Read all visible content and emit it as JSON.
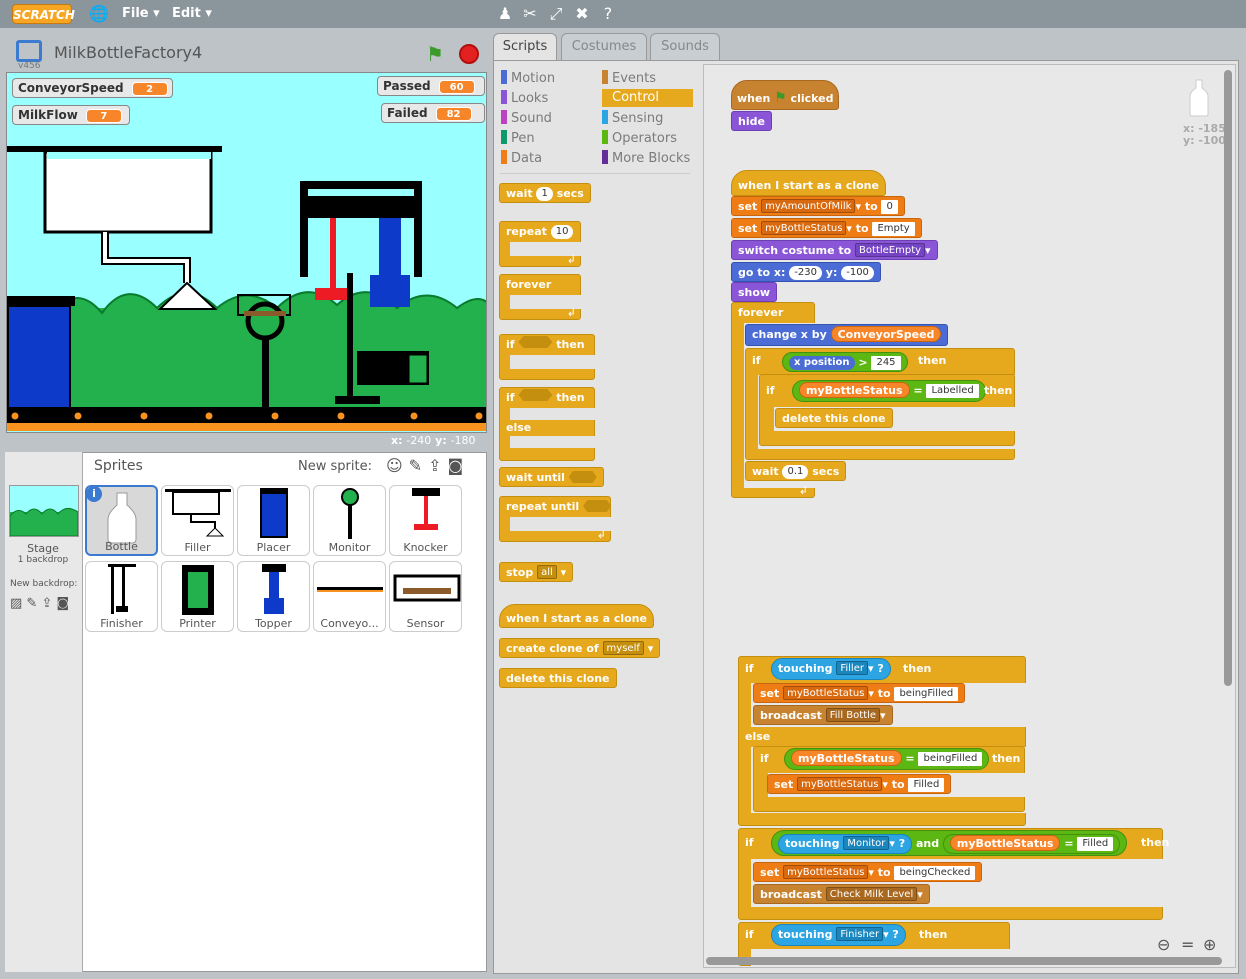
{
  "menubar": {
    "logo": "SCRATCH",
    "file": "File ▾",
    "edit": "Edit ▾"
  },
  "project": {
    "title": "MilkBottleFactory4",
    "version": "v456"
  },
  "monitors": [
    {
      "name": "ConveyorSpeed",
      "value": "2"
    },
    {
      "name": "MilkFlow",
      "value": "7"
    },
    {
      "name": "Passed",
      "value": "60"
    },
    {
      "name": "Failed",
      "value": "82"
    }
  ],
  "stage_coords": {
    "x_label": "x:",
    "x": "-240",
    "y_label": "y:",
    "y": "-180"
  },
  "sprites_panel": {
    "title": "Sprites",
    "new_sprite": "New sprite:",
    "stage_label": "Stage",
    "backdrops": "1 backdrop",
    "new_backdrop": "New backdrop:"
  },
  "sprites": [
    "Bottle",
    "Filler",
    "Placer",
    "Monitor",
    "Knocker",
    "Finisher",
    "Printer",
    "Topper",
    "Conveyo...",
    "Sensor"
  ],
  "tabs": [
    "Scripts",
    "Costumes",
    "Sounds"
  ],
  "categories": [
    "Motion",
    "Looks",
    "Sound",
    "Pen",
    "Data",
    "Events",
    "Control",
    "Sensing",
    "Operators",
    "More Blocks"
  ],
  "category_colors": [
    "#4a6cd4",
    "#8a55d7",
    "#bb42c3",
    "#0e9a6c",
    "#ee7d16",
    "#c88330",
    "#e6a81c",
    "#2ca5e2",
    "#5cb712",
    "#632d99"
  ],
  "palette": {
    "wait": "wait",
    "wait_val": "1",
    "secs": "secs",
    "repeat": "repeat",
    "repeat_val": "10",
    "forever": "forever",
    "if": "if",
    "then": "then",
    "else": "else",
    "wait_until": "wait until",
    "repeat_until": "repeat until",
    "stop": "stop",
    "stop_val": "all",
    "when_clone": "when I start as a clone",
    "create_clone": "create clone of",
    "myself": "myself",
    "delete_clone": "delete this clone"
  },
  "script": {
    "when": "when",
    "clicked": "clicked",
    "hide": "hide",
    "when_clone": "when I start as a clone",
    "set": "set",
    "to": "to",
    "var_amount": "myAmountOfMilk",
    "val_0": "0",
    "var_status": "myBottleStatus",
    "val_empty": "Empty",
    "switch_costume": "switch costume to",
    "costume": "BottleEmpty",
    "goto": "go to x:",
    "gx": "-230",
    "y": "y:",
    "gy": "-100",
    "show": "show",
    "forever": "forever",
    "change_x": "change x by",
    "conveyor_speed": "ConveyorSpeed",
    "if": "if",
    "then": "then",
    "else": "else",
    "and": "and",
    "x_position": "x position",
    "gt": ">",
    "val_245": "245",
    "eq": "=",
    "labelled": "Labelled",
    "delete_clone": "delete this clone",
    "wait": "wait",
    "wait_val": "0.1",
    "secs": "secs",
    "touching": "touching",
    "q": "?",
    "filler": "Filler",
    "being_filled": "beingFilled",
    "broadcast": "broadcast",
    "fill_bottle": "Fill Bottle",
    "filled": "Filled",
    "monitor": "Monitor",
    "being_checked": "beingChecked",
    "check_milk": "Check Milk Level",
    "finisher": "Finisher"
  },
  "canvas_coords": {
    "x": "x: -185",
    "y": "y: -100"
  }
}
